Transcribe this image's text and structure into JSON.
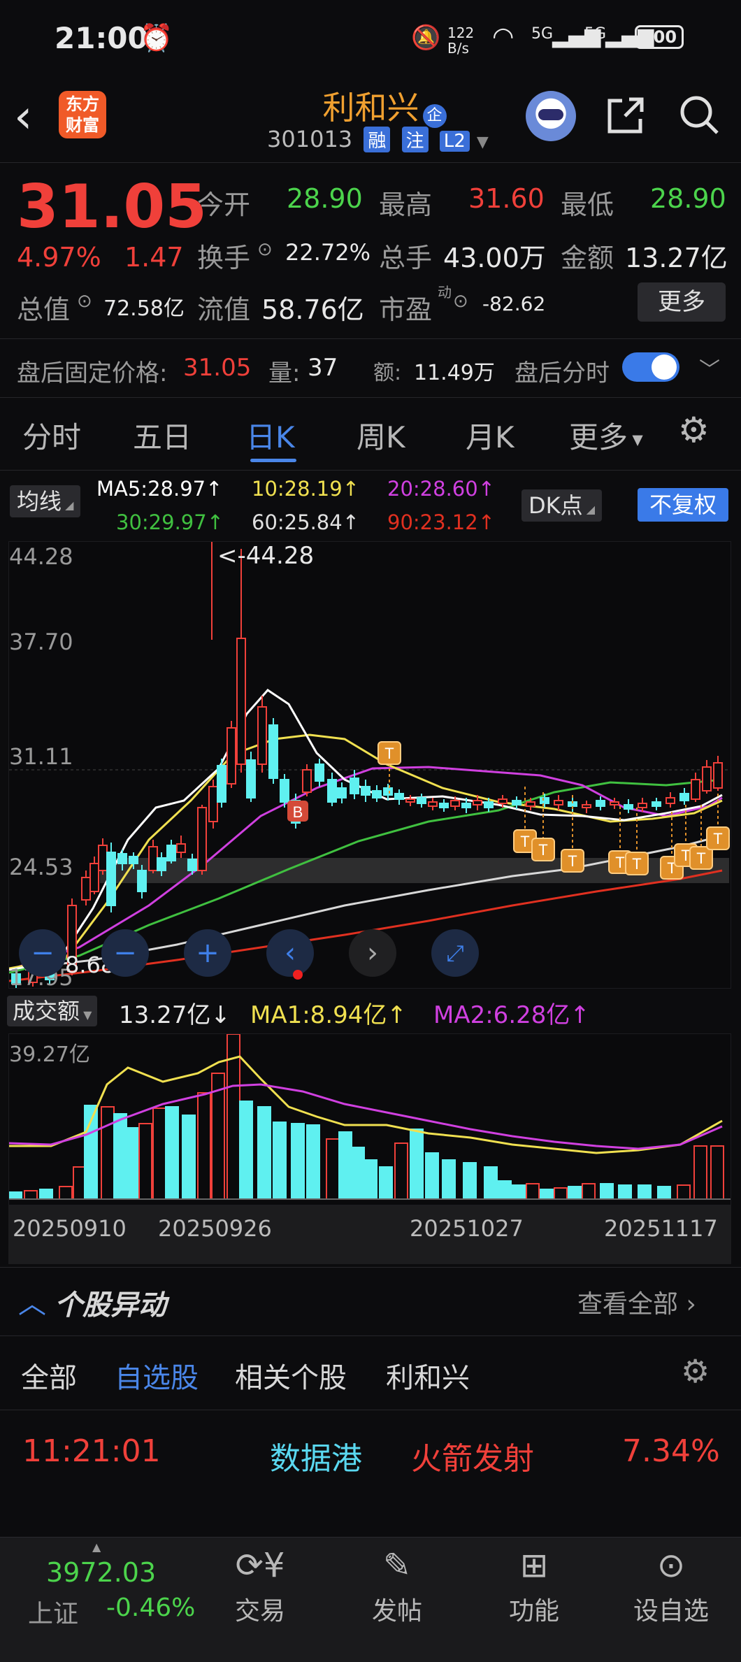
{
  "status_bar": {
    "time": "21:00",
    "net_speed": "122 B/s",
    "signal1": "5G",
    "signal2": "5G",
    "battery": "100"
  },
  "header": {
    "brand_line1": "东方",
    "brand_line2": "财富",
    "stock_name": "利和兴",
    "enterprise_tag": "企",
    "stock_code": "301013",
    "tag_rong": "融",
    "tag_zhu": "注",
    "tag_l2": "L2"
  },
  "quote": {
    "price": "31.05",
    "change_pct": "4.97%",
    "change_amt": "1.47",
    "open_label": "今开",
    "open": "28.90",
    "high_label": "最高",
    "high": "31.60",
    "low_label": "最低",
    "low": "28.90",
    "turnover_label": "换手",
    "turnover": "22.72%",
    "volume_label": "总手",
    "volume": "43.00万",
    "amount_label": "金额",
    "amount": "13.27亿",
    "mktcap_label": "总值",
    "mktcap": "72.58亿",
    "float_label": "流值",
    "float": "58.76亿",
    "pe_label": "市盈",
    "pe_sup": "动",
    "pe": "-82.62",
    "more_button": "更多"
  },
  "after_hours": {
    "price_label": "盘后固定价格:",
    "price": "31.05",
    "vol_label": "量:",
    "vol": "37",
    "amt_label": "额:",
    "amt": "11.49万",
    "toggle_label": "盘后分时",
    "toggle_on": true
  },
  "tabs": [
    "分时",
    "五日",
    "日K",
    "周K",
    "月K",
    "更多"
  ],
  "active_tab": "日K",
  "ma_panel": {
    "selector": "均线",
    "ma5": "MA5:28.97↑",
    "ma10": "10:28.19↑",
    "ma20": "20:28.60↑",
    "ma30": "30:29.97↑",
    "ma60": "60:25.84↑",
    "ma90": "90:23.12↑",
    "dk_button": "DK点",
    "adjust_button": "不复权"
  },
  "kline": {
    "y_labels": [
      "44.28",
      "37.70",
      "31.11",
      "24.53",
      "17.95"
    ],
    "max_marker": "<-44.28",
    "min_marker": "8.68",
    "buy_marker": "B",
    "t_marker": "T"
  },
  "volume_panel": {
    "selector": "成交额",
    "current": "13.27亿↓",
    "ma1": "MA1:8.94亿↑",
    "ma2": "MA2:6.28亿↑",
    "y_label": "39.27亿",
    "dates": [
      "20250910",
      "20250926",
      "20251027",
      "20251117"
    ]
  },
  "movers": {
    "title": "个股异动",
    "view_all": "查看全部",
    "filters": [
      "全部",
      "自选股",
      "相关个股",
      "利和兴"
    ],
    "active_filter": "自选股",
    "rows": [
      {
        "time": "11:21:01",
        "sector": "数据港",
        "event": "火箭发射",
        "pct": "7.34%"
      }
    ]
  },
  "bottom_nav": {
    "index_value": "3972.03",
    "index_name": "上证",
    "index_change": "-0.46%",
    "items": [
      "交易",
      "发帖",
      "功能",
      "设自选"
    ]
  },
  "colors": {
    "up": "#f0403a",
    "down": "#5ff0f0",
    "accent": "#4a86e8",
    "brand": "#f05a28",
    "ma5": "#ffffff",
    "ma10": "#f0e050",
    "ma20": "#d040e0",
    "ma30": "#40c040",
    "ma60": "#e0e0e0",
    "ma90": "#e03020"
  }
}
